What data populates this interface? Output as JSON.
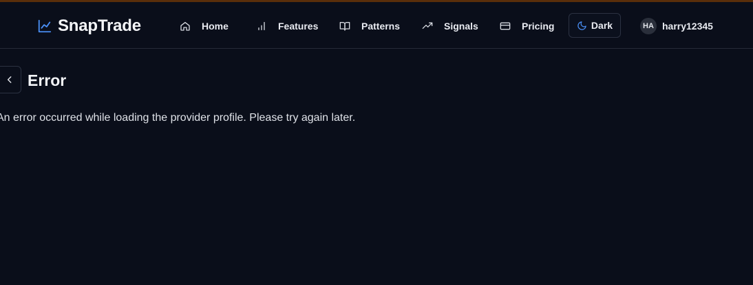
{
  "header": {
    "brand": "SnapTrade",
    "nav": [
      {
        "label": "Home",
        "icon": "home-icon"
      },
      {
        "label": "Features",
        "icon": "bar-chart-icon"
      },
      {
        "label": "Patterns",
        "icon": "book-open-icon"
      },
      {
        "label": "Signals",
        "icon": "trending-up-icon"
      },
      {
        "label": "Pricing",
        "icon": "credit-card-icon"
      }
    ],
    "theme_label": "Dark",
    "user": {
      "initials": "HA",
      "name": "harry12345"
    }
  },
  "page": {
    "title": "Error",
    "message": "An error occurred while loading the provider profile. Please try again later."
  },
  "colors": {
    "background": "#0a0e1a",
    "accent_bar": "#5a2e0a",
    "brand_icon": "#4a8ff5",
    "border": "#262b38"
  }
}
